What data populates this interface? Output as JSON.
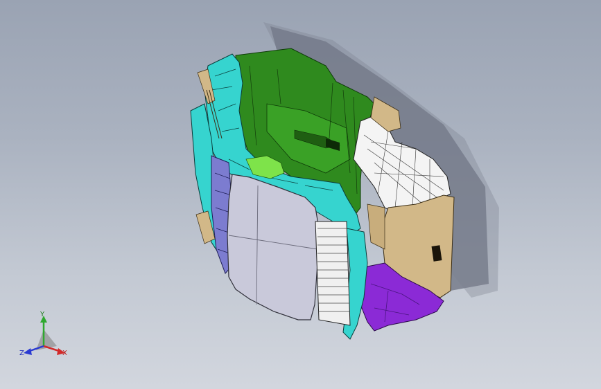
{
  "viewport": {
    "background_top": "#9aa3b3",
    "background_bottom": "#d2d6de"
  },
  "model": {
    "parts": [
      {
        "name": "green-floor-panel",
        "color": "#2f8a1e"
      },
      {
        "name": "cyan-frame",
        "color": "#36d4cf"
      },
      {
        "name": "lavender-cushion",
        "color": "#c9c9da"
      },
      {
        "name": "tan-side-panel",
        "color": "#d2b888"
      },
      {
        "name": "purple-bracket",
        "color": "#8b2ad6"
      },
      {
        "name": "white-mesh-bracket",
        "color": "#f4f4f4"
      },
      {
        "name": "blue-strip",
        "color": "#7c7cd0"
      }
    ]
  },
  "triad": {
    "y_label": "Y",
    "x_label": "X",
    "z_label": "Z",
    "y_color": "#2ea82e",
    "x_color": "#d22a2a",
    "z_color": "#2a3ad2"
  }
}
